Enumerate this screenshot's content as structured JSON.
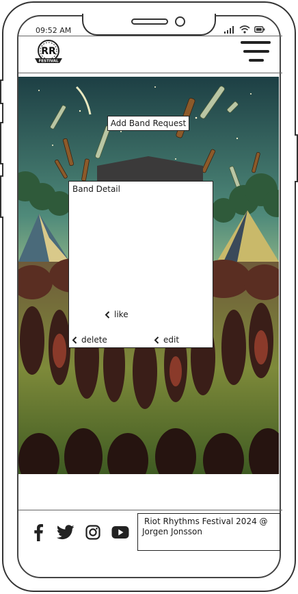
{
  "status_bar": {
    "time": "09:52 AM"
  },
  "header": {
    "logo_letters": "RR",
    "logo_banner": "FESTIVAL"
  },
  "main": {
    "add_band_request_label": "Add Band Request",
    "band_detail": {
      "title": "Band Detail",
      "like_label": "like",
      "delete_label": "delete",
      "edit_label": "edit"
    }
  },
  "footer": {
    "social_icons": [
      "facebook-icon",
      "twitter-icon",
      "instagram-icon",
      "youtube-icon"
    ],
    "copyright_line1": "Riot Rhythms Festival 2024 @",
    "copyright_line2": "Jorgen Jonsson"
  }
}
